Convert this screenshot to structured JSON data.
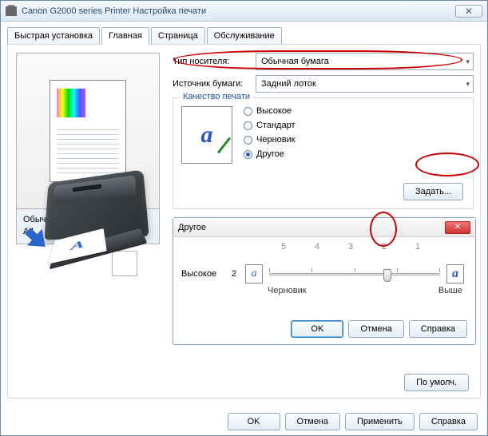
{
  "window": {
    "title": "Canon G2000 series Printer Настройка печати",
    "close_glyph": "✕"
  },
  "tabs": {
    "t0": "Быстрая установка",
    "t1": "Главная",
    "t2": "Страница",
    "t3": "Обслуживание"
  },
  "preview": {
    "media_line": "Обычная бумага",
    "size_line": "A4"
  },
  "fields": {
    "media_label": "Тип носителя:",
    "media_value": "Обычная бумага",
    "source_label": "Источник бумаги:",
    "source_value": "Задний лоток"
  },
  "quality": {
    "group_title": "Качество печати",
    "opt_high": "Высокое",
    "opt_standard": "Стандарт",
    "opt_draft": "Черновик",
    "opt_other": "Другое",
    "set_button": "Задать..."
  },
  "dialog": {
    "title": "Другое",
    "left_label": "Высокое",
    "left_num": "2",
    "ticks": {
      "t5": "5",
      "t4": "4",
      "t3": "3",
      "t2": "2",
      "t1": "1"
    },
    "sub_left": "Черновик",
    "sub_right": "Выше",
    "ok": "OK",
    "cancel": "Отмена",
    "help": "Справка",
    "slider_value": 2
  },
  "defaults_button": "По умолч.",
  "footer": {
    "ok": "OK",
    "cancel": "Отмена",
    "apply": "Применить",
    "help": "Справка"
  },
  "chart_data": {
    "type": "bar",
    "note": "quality slider",
    "categories": [
      5,
      4,
      3,
      2,
      1
    ],
    "values": [
      0,
      0,
      0,
      1,
      0
    ],
    "selected": 2,
    "xlabel": "",
    "ylabel": ""
  }
}
